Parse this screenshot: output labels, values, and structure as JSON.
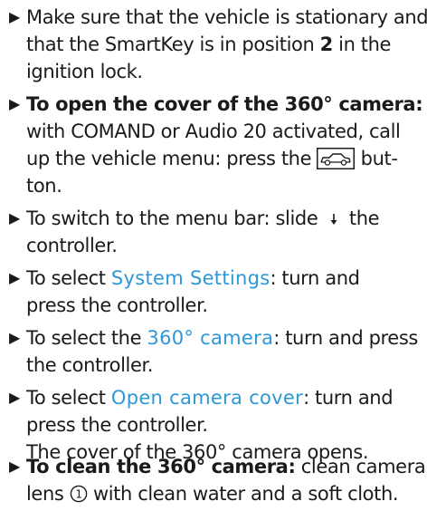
{
  "bullet_glyph": "▶",
  "steps": [
    {
      "lines": [
        {
          "text": "Make sure that the vehicle is stationary and"
        },
        {
          "pre": "that the SmartKey is in position ",
          "bold": "2",
          "post": " in the"
        },
        {
          "text": "ignition lock."
        }
      ]
    },
    {
      "lines": [
        {
          "bold": "To open the cover of the 360° camera:"
        },
        {
          "text": "with COMAND or Audio 20 activated, call"
        },
        {
          "pre": "up the vehicle menu: press the ",
          "post": " but-",
          "icon": "vehicle-button-icon"
        },
        {
          "text": "ton."
        }
      ]
    },
    {
      "lines": [
        {
          "pre": "To switch to the menu bar: slide ",
          "post": " the",
          "icon": "arrow-down-icon"
        },
        {
          "text": "controller."
        }
      ]
    },
    {
      "lines": [
        {
          "pre": "To select ",
          "display": "System Settings",
          "post": ": turn and"
        },
        {
          "text": "press the controller."
        }
      ]
    },
    {
      "lines": [
        {
          "pre": "To select the ",
          "display": "360° camera",
          "post": ": turn and press"
        },
        {
          "text": "the controller."
        }
      ]
    },
    {
      "lines": [
        {
          "pre": "To select ",
          "display": "Open camera cover",
          "post": ": turn and"
        },
        {
          "text": "press the controller."
        },
        {
          "text": "The cover of the 360° camera opens."
        }
      ]
    },
    {
      "lines": [
        {
          "bold": "To clean the 360° camera:",
          "post": " clean camera"
        },
        {
          "pre": "lens ",
          "post": " with clean water and a soft cloth.",
          "icon": "callout-1-icon",
          "callout": "1"
        }
      ]
    }
  ],
  "colors": {
    "text": "#1a1a1a",
    "display_text": "#2e97d6",
    "bullet": "#1a1a1a"
  }
}
